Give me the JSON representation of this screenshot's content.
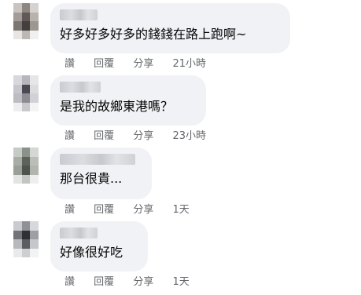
{
  "comments": [
    {
      "text": "好多好多好多的錢錢在路上跑啊~",
      "like": "讚",
      "reply": "回覆",
      "share": "分享",
      "time": "21小時"
    },
    {
      "text": "是我的故鄉東港嗎？",
      "like": "讚",
      "reply": "回覆",
      "share": "分享",
      "time": "23小時"
    },
    {
      "text": "那台很貴...",
      "like": "讚",
      "reply": "回覆",
      "share": "分享",
      "time": "1天"
    },
    {
      "text": "好像很好吃",
      "like": "讚",
      "reply": "回覆",
      "share": "分享",
      "time": "1天"
    }
  ]
}
